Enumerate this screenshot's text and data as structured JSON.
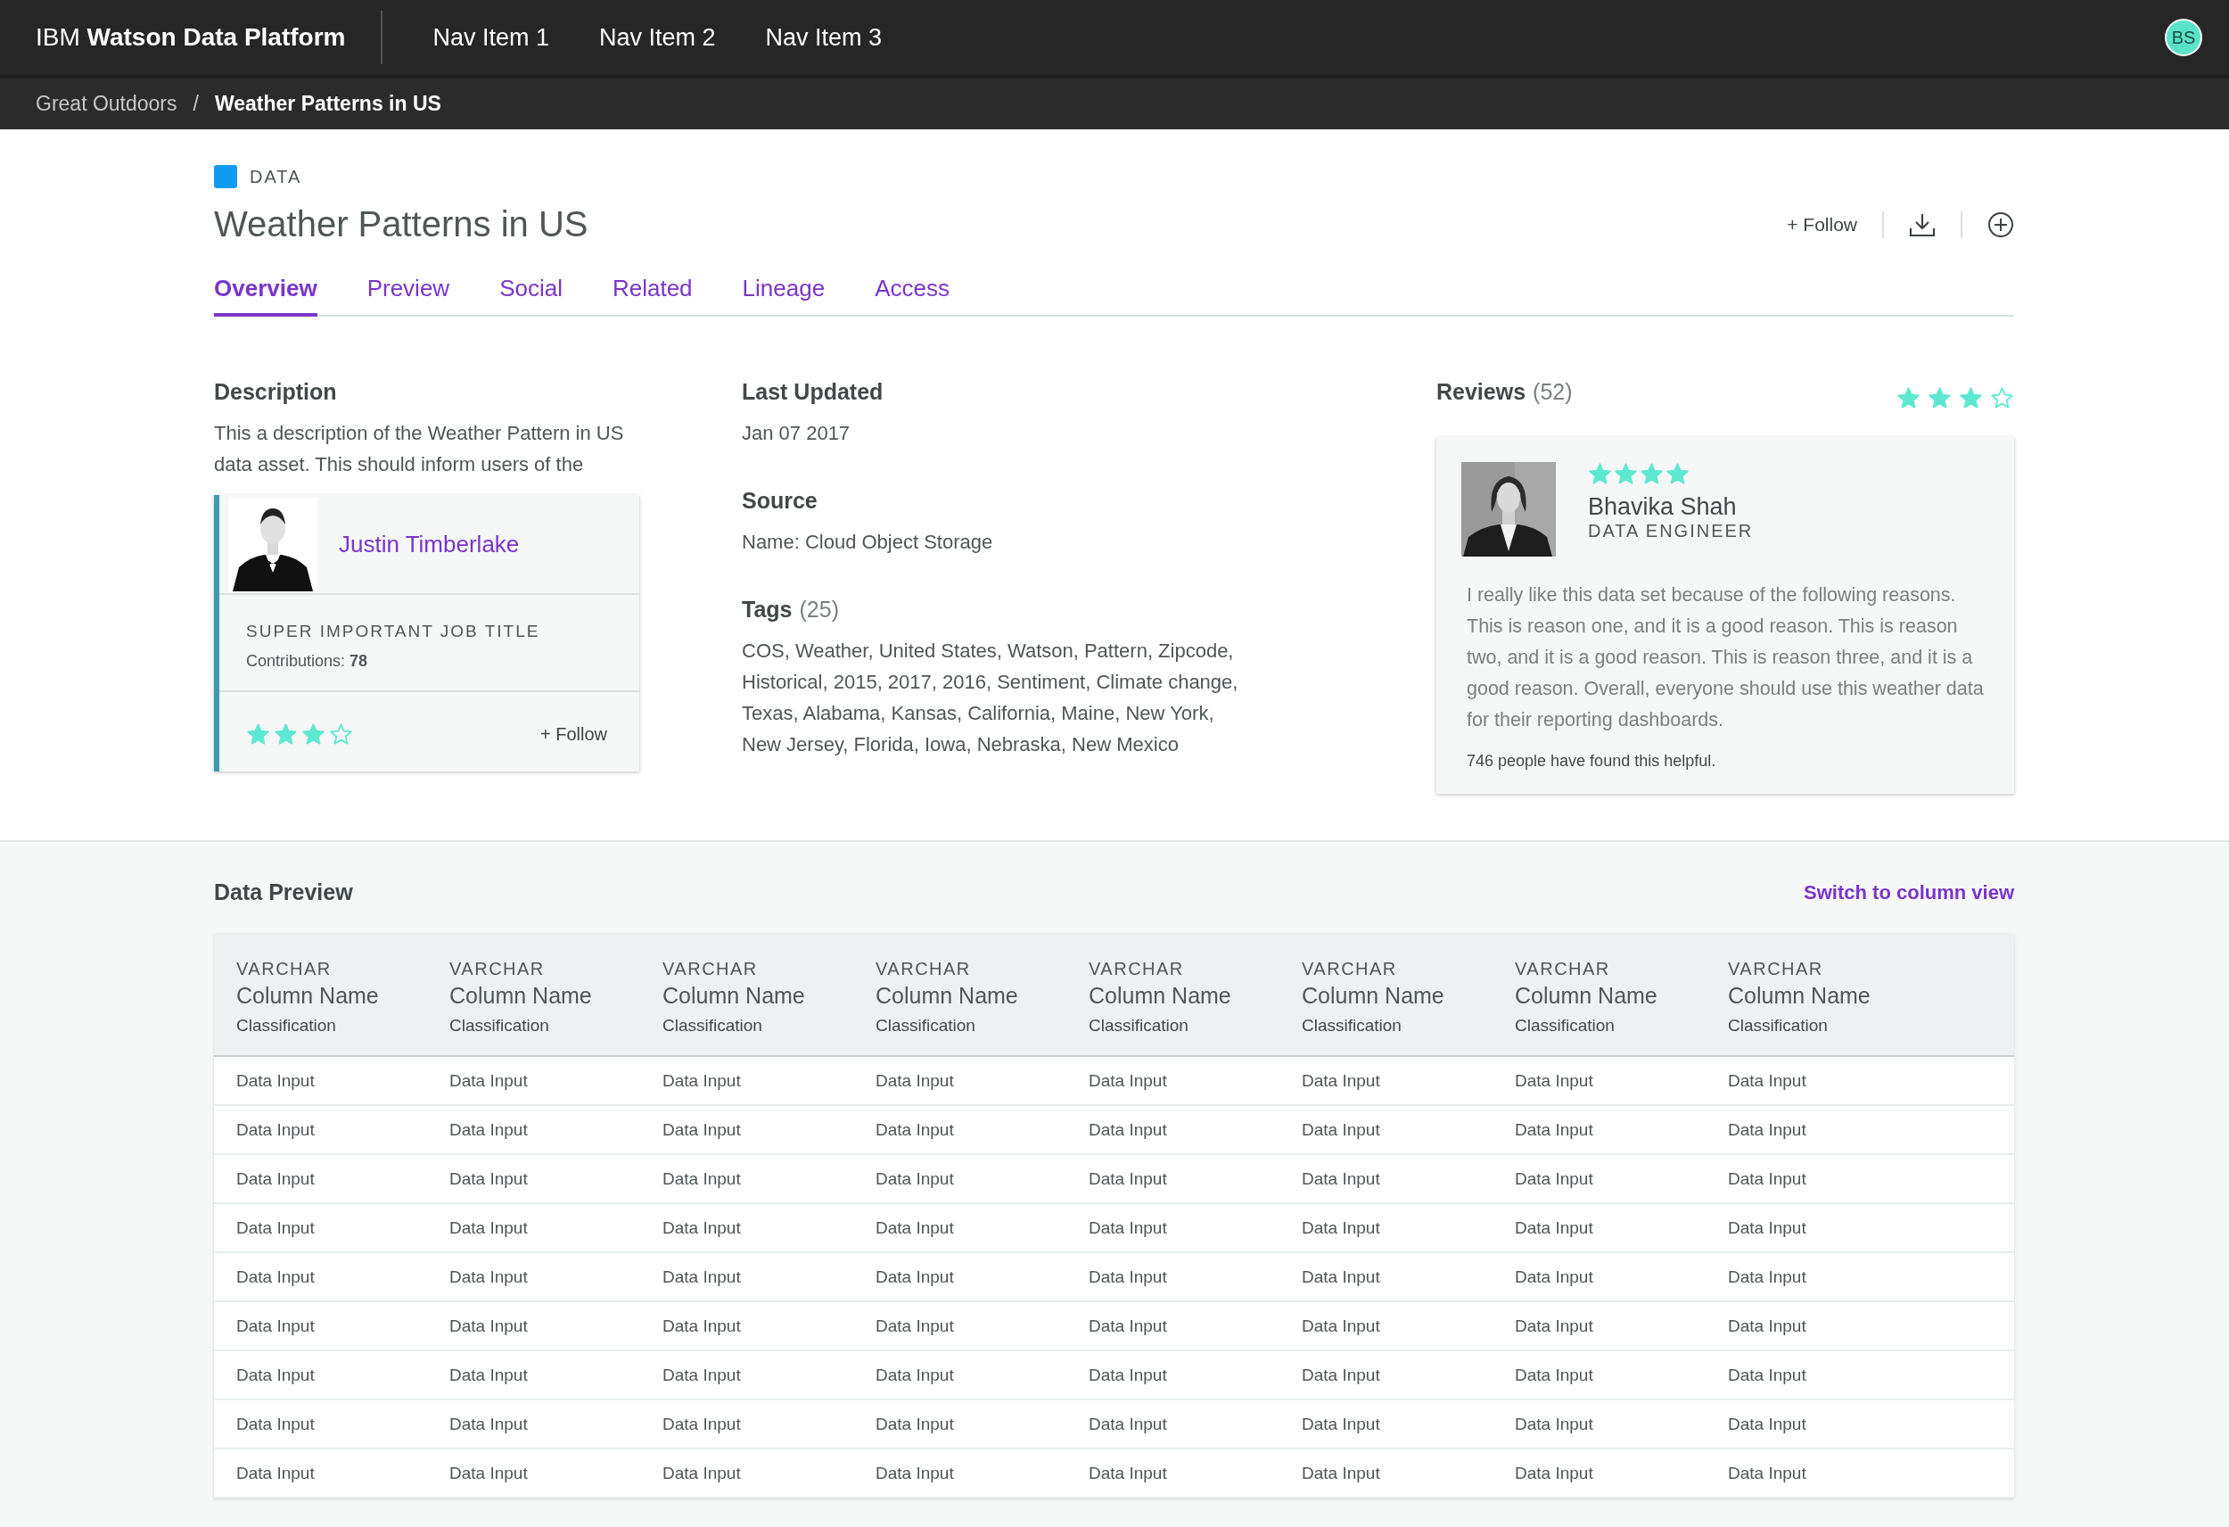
{
  "header": {
    "logo": "IBM **Watson Data Platform**",
    "nav": [
      "Nav Item 1",
      "Nav Item 2",
      "Nav Item 3"
    ],
    "avatar": "BS"
  },
  "breadcrumb": {
    "separator": "/",
    "items": [
      {
        "label": "Great Outdoors",
        "current": false
      },
      {
        "label": "Weather Patterns in US",
        "current": true
      }
    ]
  },
  "asset": {
    "type": "DATA",
    "title": "Weather Patterns in US",
    "follow": "+ Follow"
  },
  "tabs": [
    {
      "label": "Overview",
      "selected": true
    },
    {
      "label": "Preview",
      "selected": false
    },
    {
      "label": "Social",
      "selected": false
    },
    {
      "label": "Related",
      "selected": false
    },
    {
      "label": "Lineage",
      "selected": false
    },
    {
      "label": "Access",
      "selected": false
    }
  ],
  "description": {
    "heading": "Description",
    "text": "This a description of the Weather Pattern in US data asset. This should inform users of the"
  },
  "contributor_card": {
    "name": "Justin Timberlake",
    "job_title": "SUPER IMPORTANT JOB TITLE",
    "contributions": "Contributions: **78**",
    "stars": 3,
    "follow": "+ Follow"
  },
  "details": [
    {
      "heading": "Last Updated",
      "text": "Jan 07 2017"
    },
    {
      "heading": "Source",
      "text": "Name: Cloud Object Storage"
    },
    {
      "heading": "Tags",
      "count": "(25)",
      "text": "COS, Weather, United States, Watson, Pattern, Zipcode, Historical, 2015, 2017, 2016, Sentiment, Climate change, Texas, Alabama, Kansas, California, Maine, New York, New Jersey, Florida, Iowa, Nebraska, New Mexico"
    }
  ],
  "reviews": {
    "heading": "Reviews",
    "count": "(52)",
    "stars": 3,
    "review": {
      "stars": 4,
      "name": "Bhavika Shah",
      "role": "DATA ENGINEER",
      "text": "I really like this data set because of the following reasons. This is reason one, and it is a good reason. This is reason two, and it is a good reason. This is reason three, and it is a good reason. Overall, everyone should use this weather data for their reporting dashboards.",
      "helpful": "746 people have found this helpful."
    }
  },
  "data_preview": {
    "heading": "Data Preview",
    "switch_link": "Switch to column view",
    "columns": [
      {
        "type": "VARCHAR",
        "name": "Column Name",
        "classification": "Classification"
      },
      {
        "type": "VARCHAR",
        "name": "Column Name",
        "classification": "Classification"
      },
      {
        "type": "VARCHAR",
        "name": "Column Name",
        "classification": "Classification"
      },
      {
        "type": "VARCHAR",
        "name": "Column Name",
        "classification": "Classification"
      },
      {
        "type": "VARCHAR",
        "name": "Column Name",
        "classification": "Classification"
      },
      {
        "type": "VARCHAR",
        "name": "Column Name",
        "classification": "Classification"
      },
      {
        "type": "VARCHAR",
        "name": "Column Name",
        "classification": "Classification"
      },
      {
        "type": "VARCHAR",
        "name": "Column Name",
        "classification": "Classification"
      }
    ],
    "rows": [
      [
        "Data Input",
        "Data Input",
        "Data Input",
        "Data Input",
        "Data Input",
        "Data Input",
        "Data Input",
        "Data Input"
      ],
      [
        "Data Input",
        "Data Input",
        "Data Input",
        "Data Input",
        "Data Input",
        "Data Input",
        "Data Input",
        "Data Input"
      ],
      [
        "Data Input",
        "Data Input",
        "Data Input",
        "Data Input",
        "Data Input",
        "Data Input",
        "Data Input",
        "Data Input"
      ],
      [
        "Data Input",
        "Data Input",
        "Data Input",
        "Data Input",
        "Data Input",
        "Data Input",
        "Data Input",
        "Data Input"
      ],
      [
        "Data Input",
        "Data Input",
        "Data Input",
        "Data Input",
        "Data Input",
        "Data Input",
        "Data Input",
        "Data Input"
      ],
      [
        "Data Input",
        "Data Input",
        "Data Input",
        "Data Input",
        "Data Input",
        "Data Input",
        "Data Input",
        "Data Input"
      ],
      [
        "Data Input",
        "Data Input",
        "Data Input",
        "Data Input",
        "Data Input",
        "Data Input",
        "Data Input",
        "Data Input"
      ],
      [
        "Data Input",
        "Data Input",
        "Data Input",
        "Data Input",
        "Data Input",
        "Data Input",
        "Data Input",
        "Data Input"
      ],
      [
        "Data Input",
        "Data Input",
        "Data Input",
        "Data Input",
        "Data Input",
        "Data Input",
        "Data Input",
        "Data Input"
      ]
    ]
  }
}
